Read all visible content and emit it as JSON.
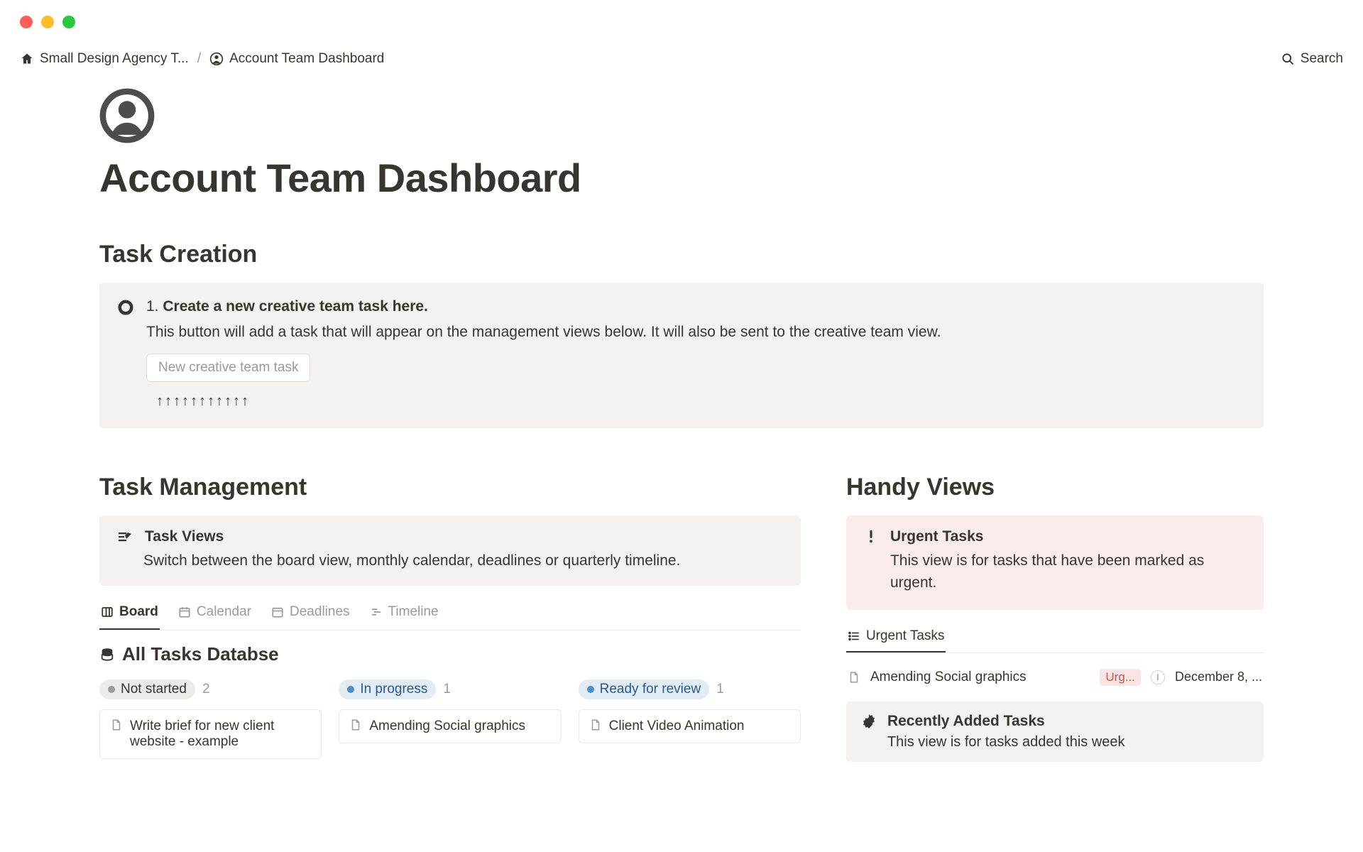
{
  "breadcrumb": {
    "item1": "Small Design Agency T...",
    "separator": "/",
    "item2": "Account Team Dashboard"
  },
  "search": {
    "label": "Search"
  },
  "page": {
    "title": "Account Team Dashboard"
  },
  "task_creation": {
    "heading": "Task Creation",
    "callout_num": "1. ",
    "callout_bold": "Create a new creative team task here.",
    "callout_body": "This button will add a task that will appear on the management views below. It will also be sent to the creative team view.",
    "button": "New creative team task",
    "arrows": "↑↑↑↑↑↑↑↑↑↑↑"
  },
  "task_management": {
    "heading": "Task Management",
    "callout_title": "Task Views",
    "callout_body": "Switch between the board view, monthly calendar, deadlines or quarterly timeline.",
    "tabs": [
      "Board",
      "Calendar",
      "Deadlines",
      "Timeline"
    ],
    "db_title": "All Tasks Databse",
    "columns": [
      {
        "label": "Not started",
        "count": "2",
        "card": "Write brief for new client website - example"
      },
      {
        "label": "In progress",
        "count": "1",
        "card": "Amending Social graphics"
      },
      {
        "label": "Ready for review",
        "count": "1",
        "card": "Client Video Animation"
      }
    ]
  },
  "handy_views": {
    "heading": "Handy Views",
    "urgent_callout_title": "Urgent Tasks",
    "urgent_callout_body": "This view is for tasks that have been marked as urgent.",
    "urgent_tab": "Urgent Tasks",
    "urgent_item": {
      "title": "Amending Social graphics",
      "badge": "Urg...",
      "assignee": "I",
      "date": "December 8, ..."
    },
    "recent_title": "Recently Added Tasks",
    "recent_body": "This view is for tasks added this week"
  }
}
